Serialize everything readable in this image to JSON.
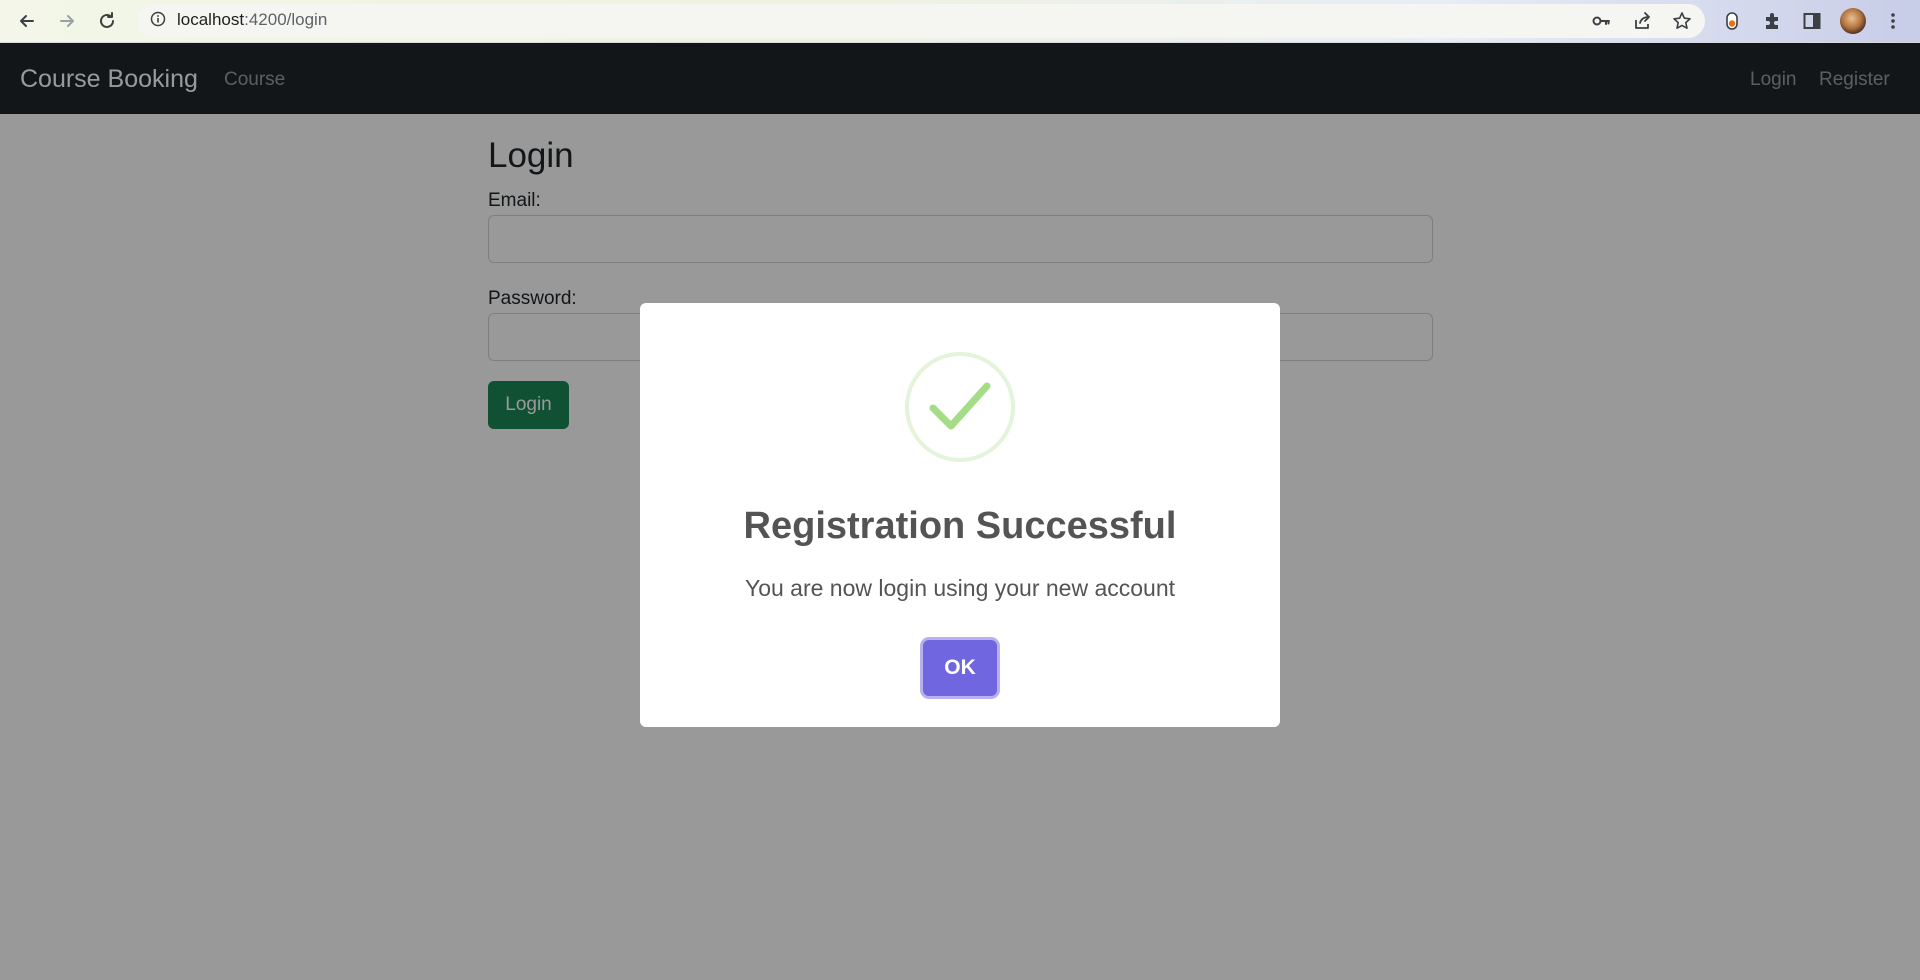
{
  "browser": {
    "url_host": "localhost",
    "url_path": ":4200/login",
    "icons": [
      "back-arrow-icon",
      "forward-arrow-icon",
      "reload-icon",
      "site-info-icon",
      "key-icon",
      "share-icon",
      "bookmark-star-icon",
      "extension-toggle-icon",
      "puzzle-extensions-icon",
      "side-panel-icon",
      "profile-avatar",
      "kebab-menu-icon"
    ]
  },
  "navbar": {
    "brand": "Course Booking",
    "links": [
      "Course"
    ],
    "right_links": [
      "Login",
      "Register"
    ]
  },
  "form": {
    "title": "Login",
    "email_label": "Email:",
    "email_value": "",
    "password_label": "Password:",
    "password_value": "",
    "submit_label": "Login"
  },
  "modal": {
    "icon": "success-check-icon",
    "title": "Registration Successful",
    "text": "You are now login using your new account",
    "confirm_label": "OK"
  },
  "colors": {
    "navbar_bg": "#212529",
    "login_button": "#198754",
    "ok_button": "#7066e0",
    "success_check": "#a5dc86"
  }
}
